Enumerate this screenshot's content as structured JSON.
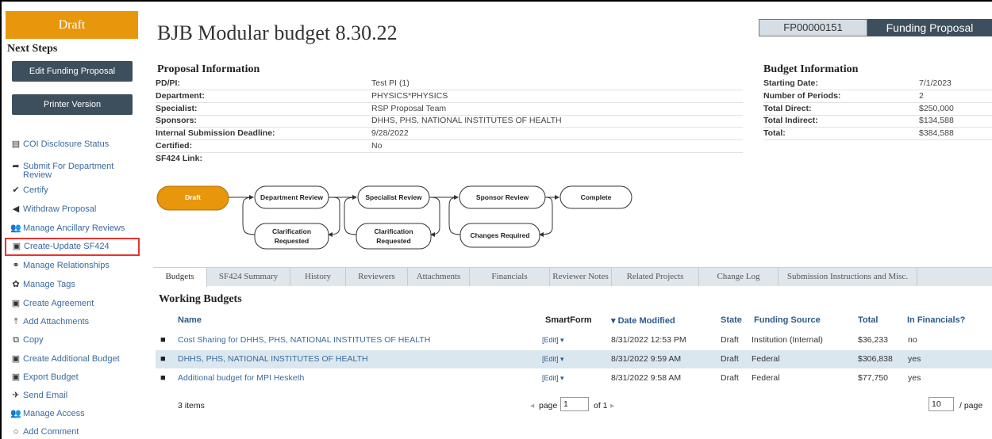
{
  "sidebar": {
    "state": "Draft",
    "next_steps": "Next Steps",
    "edit_button": "Edit Funding Proposal",
    "printer_button": "Printer Version",
    "actions": [
      {
        "label": "COI Disclosure Status",
        "icon": "list-icon",
        "glyph": "▤"
      },
      {
        "label": "Submit For Department Review",
        "icon": "arrow-forward-icon",
        "glyph": "➦"
      },
      {
        "label": "Certify",
        "icon": "check-icon",
        "glyph": "✔"
      },
      {
        "label": "Withdraw Proposal",
        "icon": "arrow-left-icon",
        "glyph": "◀"
      },
      {
        "label": "Manage Ancillary Reviews",
        "icon": "users-icon",
        "glyph": "👥"
      },
      {
        "label": "Create-Update SF424",
        "icon": "form-icon",
        "glyph": "▣"
      },
      {
        "label": "Manage Relationships",
        "icon": "relationship-icon",
        "glyph": "⚭"
      },
      {
        "label": "Manage Tags",
        "icon": "gear-icon",
        "glyph": "✿"
      },
      {
        "label": "Create Agreement",
        "icon": "form-icon",
        "glyph": "▣"
      },
      {
        "label": "Add Attachments",
        "icon": "upload-icon",
        "glyph": "⤒"
      },
      {
        "label": "Copy",
        "icon": "copy-icon",
        "glyph": "⧉"
      },
      {
        "label": "Create Additional Budget",
        "icon": "form-icon",
        "glyph": "▣"
      },
      {
        "label": "Export Budget",
        "icon": "export-icon",
        "glyph": "▣"
      },
      {
        "label": "Send Email",
        "icon": "send-icon",
        "glyph": "✈"
      },
      {
        "label": "Manage Access",
        "icon": "users-icon",
        "glyph": "👥"
      },
      {
        "label": "Add Comment",
        "icon": "comment-icon",
        "glyph": "○"
      }
    ]
  },
  "header": {
    "title": "BJB Modular budget 8.30.22",
    "id": "FP00000151",
    "type": "Funding Proposal"
  },
  "proposal": {
    "heading": "Proposal Information",
    "rows": [
      {
        "key": "PD/PI:",
        "value": "Test PI (1)"
      },
      {
        "key": "Department:",
        "value": "PHYSICS*PHYSICS"
      },
      {
        "key": "Specialist:",
        "value": "RSP Proposal Team"
      },
      {
        "key": "Sponsors:",
        "value": "DHHS, PHS, NATIONAL INSTITUTES OF HEALTH"
      },
      {
        "key": "Internal Submission Deadline:",
        "value": "9/28/2022"
      },
      {
        "key": "Certified:",
        "value": "No"
      },
      {
        "key": "SF424 Link:",
        "value": ""
      }
    ]
  },
  "budget_info": {
    "heading": "Budget Information",
    "rows": [
      {
        "key": "Starting Date:",
        "value": "7/1/2023"
      },
      {
        "key": "Number of Periods:",
        "value": "2"
      },
      {
        "key": "Total Direct:",
        "value": "$250,000"
      },
      {
        "key": "Total Indirect:",
        "value": "$134,588"
      },
      {
        "key": "Total:",
        "value": "$384,588"
      }
    ]
  },
  "workflow": {
    "draft": "Draft",
    "dept_review": "Department Review",
    "specialist_review": "Specialist Review",
    "sponsor_review": "Sponsor Review",
    "complete": "Complete",
    "clarification1_l1": "Clarification",
    "clarification1_l2": "Requested",
    "clarification2_l1": "Clarification",
    "clarification2_l2": "Requested",
    "changes_required": "Changes Required",
    "active_color": "#e8960c"
  },
  "tabs": [
    "Budgets",
    "SF424 Summary",
    "History",
    "Reviewers",
    "Attachments",
    "Financials",
    "Reviewer Notes",
    "Related Projects",
    "Change Log",
    "Submission Instructions and Misc."
  ],
  "working_budgets": {
    "heading": "Working Budgets",
    "columns": {
      "name": "Name",
      "smartform": "SmartForm",
      "date": "▾ Date Modified",
      "state": "State",
      "source": "Funding Source",
      "total": "Total",
      "financials": "In Financials?"
    },
    "rows": [
      {
        "name": "Cost Sharing for DHHS, PHS, NATIONAL INSTITUTES OF HEALTH",
        "smartform": "[Edit] ▾",
        "date": "8/31/2022 12:53 PM",
        "state": "Draft",
        "source": "Institution (Internal)",
        "total": "$36,233",
        "financials": "no"
      },
      {
        "name": "DHHS, PHS, NATIONAL INSTITUTES OF HEALTH",
        "smartform": "[Edit] ▾",
        "date": "8/31/2022 9:59 AM",
        "state": "Draft",
        "source": "Federal",
        "total": "$306,838",
        "financials": "yes"
      },
      {
        "name": "Additional budget for MPI Hesketh",
        "smartform": "[Edit] ▾",
        "date": "8/31/2022 9:58 AM",
        "state": "Draft",
        "source": "Federal",
        "total": "$77,750",
        "financials": "yes"
      }
    ],
    "count": "3 items",
    "page_label": "page",
    "page_value": "1",
    "of_pages": "of 1",
    "page_size": "10",
    "per_page": "/ page"
  }
}
